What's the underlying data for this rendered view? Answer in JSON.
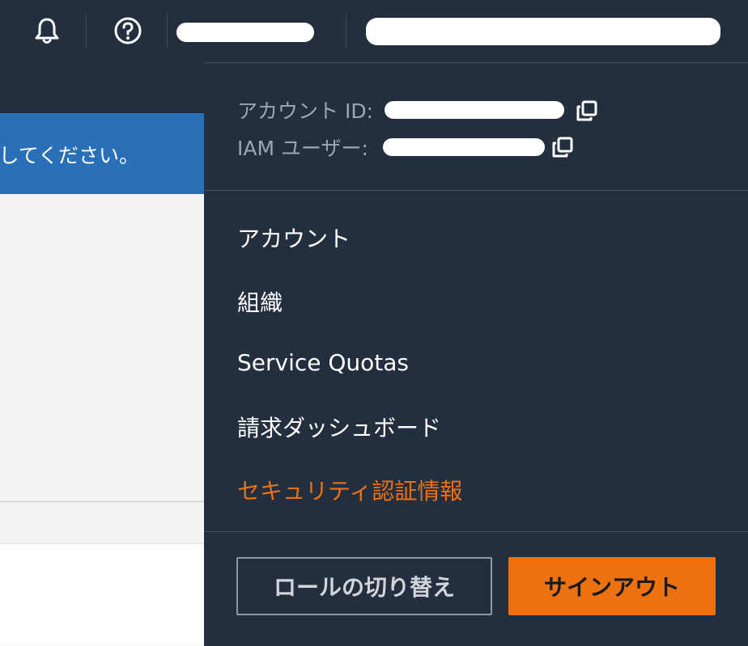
{
  "header": {
    "notifications_icon": "bell-icon",
    "help_icon": "question-circle-icon"
  },
  "banner": {
    "text": "してください。"
  },
  "account_menu": {
    "account_id_label": "アカウント ID:",
    "iam_user_label": "IAM ユーザー:",
    "copy_icon": "copy-icon",
    "items": [
      {
        "label": "アカウント"
      },
      {
        "label": "組織"
      },
      {
        "label": "Service Quotas"
      },
      {
        "label": "請求ダッシュボード"
      },
      {
        "label": "セキュリティ認証情報",
        "active": true
      }
    ],
    "switch_role_label": "ロールの切り替え",
    "sign_out_label": "サインアウト"
  },
  "colors": {
    "nav_bg": "#232f3e",
    "accent": "#ec7211",
    "banner_blue": "#2a70b8"
  }
}
